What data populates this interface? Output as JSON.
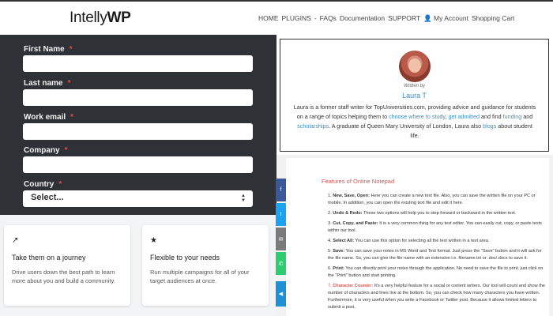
{
  "header": {
    "logo_prefix": "Intelly",
    "logo_bold": "WP",
    "nav": [
      "HOME",
      "PLUGINS",
      "-",
      "FAQs",
      "Documentation",
      "SUPPORT",
      "👤 My Account",
      "Shopping Cart"
    ]
  },
  "form": {
    "fields": [
      {
        "label": "First Name",
        "required": "*",
        "value": ""
      },
      {
        "label": "Last name",
        "required": "*",
        "value": ""
      },
      {
        "label": "Work email",
        "required": "*",
        "value": ""
      },
      {
        "label": "Company",
        "required": "*",
        "value": ""
      }
    ],
    "country": {
      "label": "Country",
      "required": "*",
      "selected": "Select..."
    }
  },
  "features": [
    {
      "icon": "trend-icon",
      "glyph": "↗",
      "title": "Take them on a journey",
      "desc": "Drive users down the best path to learn more about you and build a community."
    },
    {
      "icon": "star-icon",
      "glyph": "★",
      "title": "Flexible to your needs",
      "desc": "Run multiple campaigns for all of your target audiences at once."
    }
  ],
  "author": {
    "written_by": "Written by",
    "name": "Laura T",
    "bio_1": "Laura is a former staff writer for TopUniversities.com, providing advice and guidance for students on a range of topics helping them to ",
    "link_1": "choose where to study",
    "bio_2": ", ",
    "link_2": "get admitted",
    "bio_3": " and find ",
    "link_3": "funding",
    "bio_4": " and ",
    "link_4": "scholarships",
    "bio_5": ". A graduate of Queen Mary University of London, Laura also ",
    "link_5": "blogs",
    "bio_6": " about student life."
  },
  "notepad": {
    "title": "Features of Online Notepad",
    "items": [
      {
        "num": "1.",
        "bold": "New, Save, Open:",
        "text": " Here you can create a new text file. Also, you can save the written file on your PC or mobile. In addition, you can open the existing text file and edit it here."
      },
      {
        "num": "2.",
        "bold": "Undo & Redo:",
        "text": " These two options will help you to step forward or backward in the written text."
      },
      {
        "num": "3.",
        "bold": "Cut, Copy, and Paste:",
        "text": " It is a very common thing for any text editor. You can easily cut, copy, or paste texts within our tool."
      },
      {
        "num": "4.",
        "bold": "Select All:",
        "text": " You can use this option for selecting all the text written in a text area."
      },
      {
        "num": "5.",
        "bold": "Save:",
        "text": " You can save your notes in MS Word and Text format. Just press the \"Save\" button and it will ask for the file name. So, you can give the file name with an extension i.e. filename.txt or .doc/.docx to save it."
      },
      {
        "num": "6.",
        "bold": "Print:",
        "text": " You can directly print your notes through the application. No need to save the file to print, just click on the \"Print\" button and start printing."
      },
      {
        "num": "7.",
        "bold": "Character Counter:",
        "text": " It's a very helpful feature for a social or content writers. Our tool will count and show the number of characters and lines live at the bottom. So, you can check how many characters you have written. Furthermore, it is very useful when you write a Facebook or Twitter post. Because it allows limited letters to submit a post."
      }
    ]
  },
  "share": [
    {
      "name": "facebook-share-button",
      "glyph": "f",
      "color": "#3b5998"
    },
    {
      "name": "twitter-share-button",
      "glyph": "t",
      "color": "#1da1f2"
    },
    {
      "name": "email-share-button",
      "glyph": "✉",
      "color": "#7a7a7a"
    },
    {
      "name": "sms-share-button",
      "glyph": "✆",
      "color": "#2ecc71"
    },
    {
      "name": "share-toggle-button",
      "glyph": "◀",
      "color": "#1e90d6"
    }
  ]
}
